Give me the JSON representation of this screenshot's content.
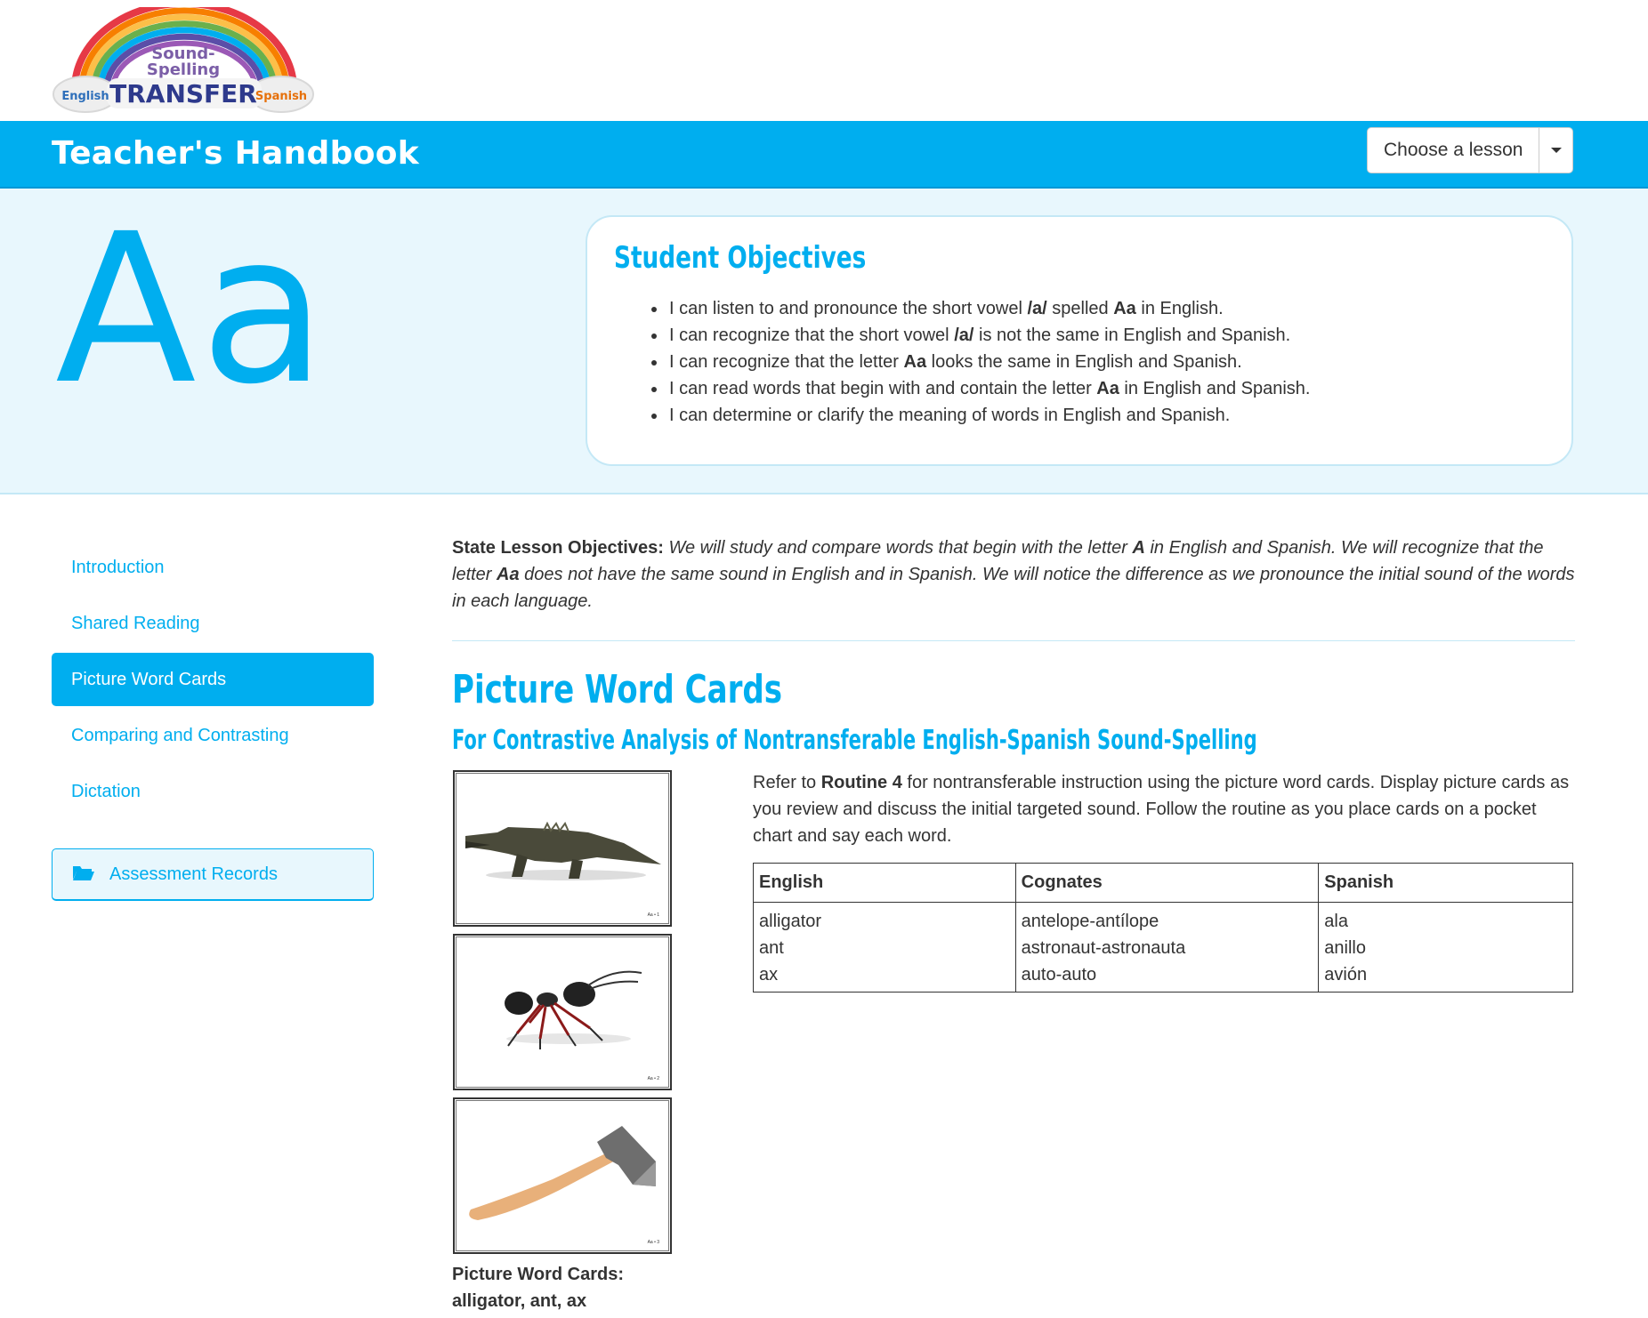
{
  "logo": {
    "line1": "Sound-",
    "line2": "Spelling",
    "main": "TRANSFER",
    "left_tag": "English",
    "right_tag": "Spanish"
  },
  "header": {
    "title": "Teacher's Handbook",
    "lesson_select_label": "Choose a lesson"
  },
  "hero": {
    "letter": "Aa",
    "objectives_title": "Student Objectives"
  },
  "sidebar": {
    "items": [
      {
        "label": "Introduction",
        "active": false
      },
      {
        "label": "Shared Reading",
        "active": false
      },
      {
        "label": "Picture Word Cards",
        "active": true
      },
      {
        "label": "Comparing and Contrasting",
        "active": false
      },
      {
        "label": "Dictation",
        "active": false
      }
    ],
    "assessment_label": "Assessment Records",
    "assessment_icon": "folder-open-icon"
  },
  "state_lesson": {
    "label": "State Lesson Objectives:"
  },
  "section": {
    "title": "Picture Word Cards",
    "subtitle": "For Contrastive Analysis of Nontransferable English-Spanish Sound-Spelling"
  },
  "cards": [
    {
      "icon": "alligator-icon",
      "number": "Aa • 1"
    },
    {
      "icon": "ant-icon",
      "number": "Aa • 2"
    },
    {
      "icon": "ax-icon",
      "number": "Aa • 3"
    }
  ],
  "cards_caption": {
    "line1": "Picture Word Cards:",
    "line2": "alligator, ant, ax"
  },
  "table": {
    "headers": [
      "English",
      "Cognates",
      "Spanish"
    ],
    "english": [
      "alligator",
      "ant",
      "ax"
    ],
    "cognates": [
      "antelope-antílope",
      "astronaut-astronauta",
      "auto-auto"
    ],
    "spanish": [
      "ala",
      "anillo",
      "avión"
    ]
  },
  "colors": {
    "brand_blue": "#00aeef",
    "hero_bg": "#e8f7fd",
    "text": "#333333"
  }
}
